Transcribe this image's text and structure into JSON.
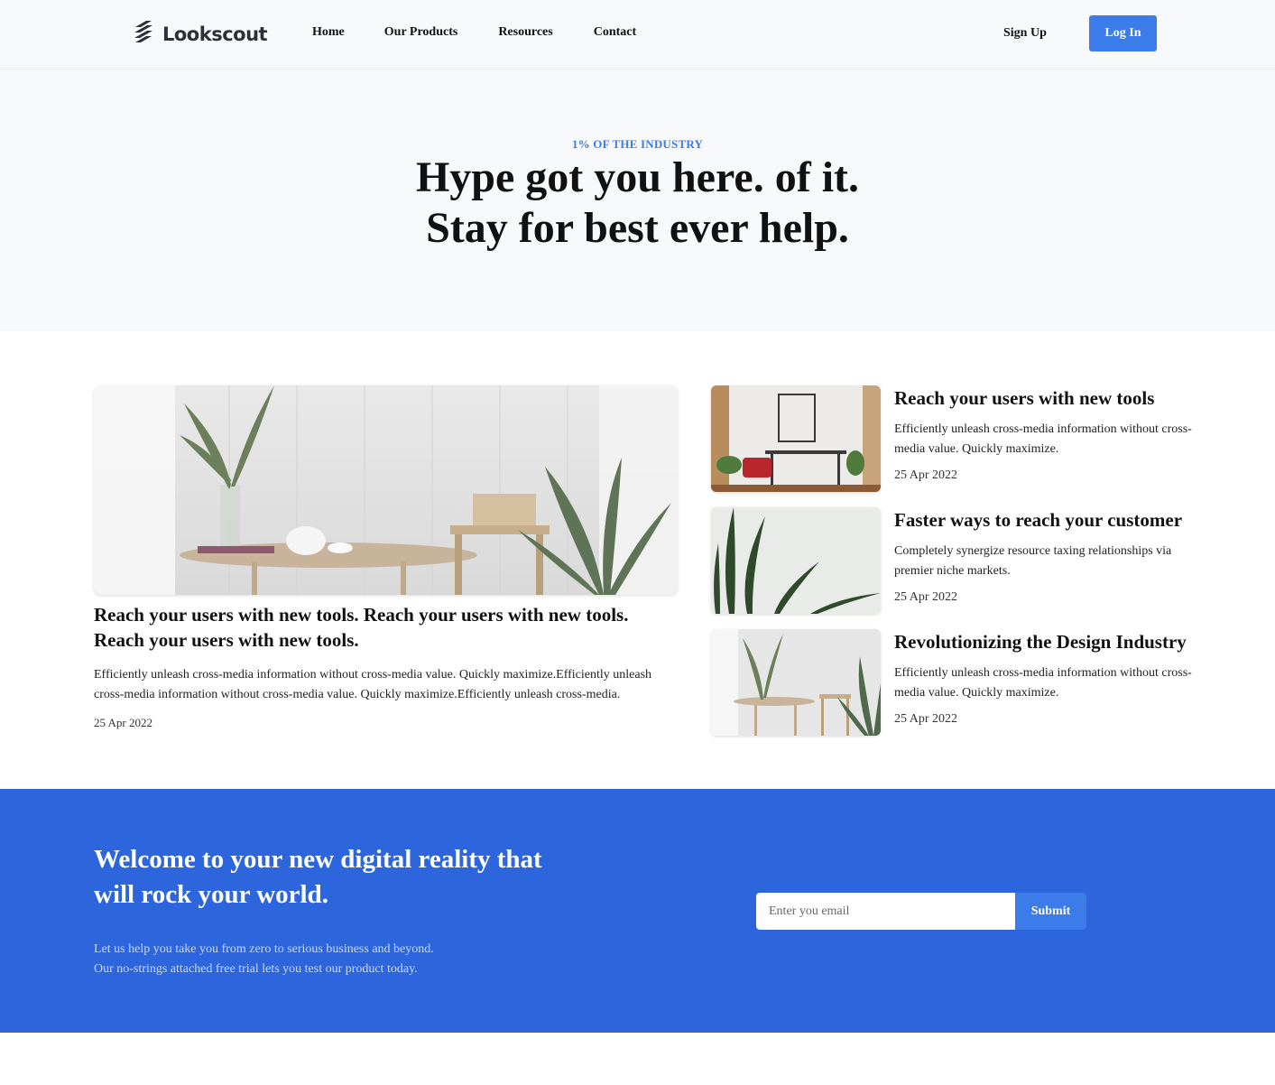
{
  "brand": {
    "name": "Lookscout",
    "icon": "stacked-bars-logo-icon"
  },
  "nav": {
    "items": [
      {
        "label": "Home"
      },
      {
        "label": "Our Products"
      },
      {
        "label": "Resources"
      },
      {
        "label": "Contact"
      }
    ],
    "signup_label": "Sign Up",
    "login_label": "Log In"
  },
  "hero": {
    "kicker": "1% of the industry",
    "title_line1": "Hype got you here. of it.",
    "title_line2": "Stay for best ever help."
  },
  "featured": {
    "title": "Reach your users with new tools. Reach your users with new tools. Reach your users with new tools.",
    "description": "Efficiently unleash cross-media information without cross-media value. Quickly maximize.Efficiently unleash cross-media information without cross-media value. Quickly maximize.Efficiently unleash cross-media.",
    "date": "25 Apr 2022",
    "image": "dining-room-with-plants-image"
  },
  "articles": [
    {
      "title": "Reach your users with new tools",
      "description": "Efficiently unleash cross-media information without cross-media value. Quickly maximize.",
      "date": "25 Apr 2022",
      "image": "desk-with-red-chair-image"
    },
    {
      "title": "Faster ways to reach your customer",
      "description": "Completely synergize resource taxing relationships via premier niche markets.",
      "date": "25 Apr 2022",
      "image": "plant-leaves-image"
    },
    {
      "title": "Revolutionizing the Design Industry",
      "description": "Efficiently unleash cross-media information without cross-media value. Quickly maximize.",
      "date": "25 Apr 2022",
      "image": "table-and-chair-image"
    }
  ],
  "cta": {
    "title": "Welcome to your new digital reality that will rock your world.",
    "line1": "Let us help you take you from zero to serious business and beyond.",
    "line2": "Our no-strings attached free trial lets you test our product today.",
    "email_placeholder": "Enter you email",
    "submit_label": "Submit"
  },
  "colors": {
    "accent": "#3b7bea",
    "cta_background": "#2d66dc",
    "header_background": "#f8f9fa"
  }
}
